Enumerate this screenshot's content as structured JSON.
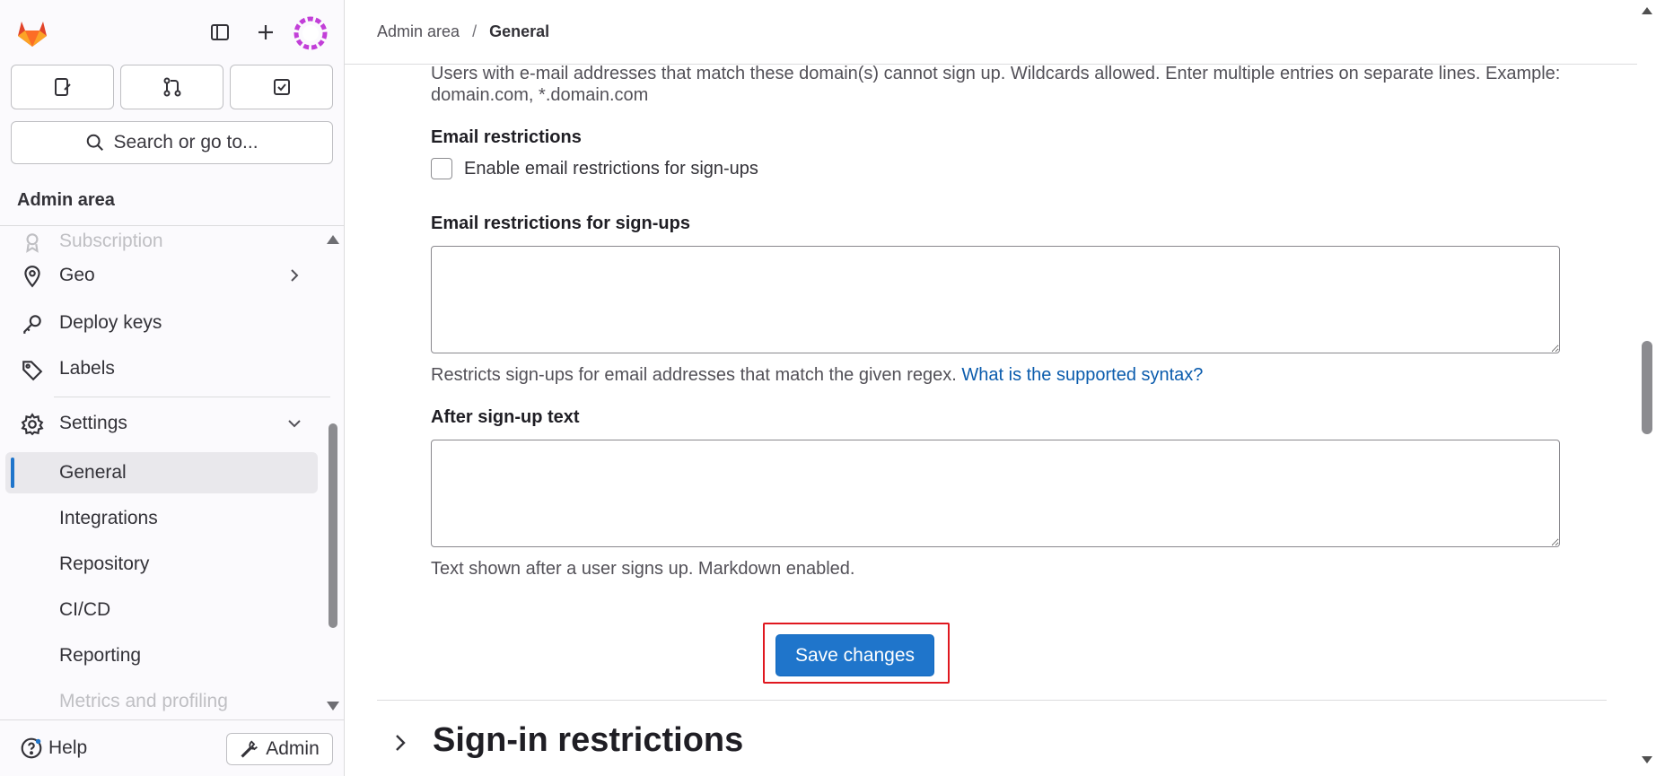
{
  "sidebar": {
    "search_label": "Search or go to...",
    "section_title": "Admin area",
    "items": [
      {
        "label": "Subscription",
        "icon": "subscription-icon"
      },
      {
        "label": "Geo",
        "icon": "location-icon"
      },
      {
        "label": "Deploy keys",
        "icon": "key-icon"
      },
      {
        "label": "Labels",
        "icon": "label-icon"
      },
      {
        "label": "Settings",
        "icon": "settings-icon"
      },
      {
        "label": "General"
      },
      {
        "label": "Integrations"
      },
      {
        "label": "Repository"
      },
      {
        "label": "CI/CD"
      },
      {
        "label": "Reporting"
      },
      {
        "label": "Metrics and profiling"
      }
    ],
    "help_label": "Help",
    "admin_label": "Admin"
  },
  "breadcrumb": {
    "parent": "Admin area",
    "separator": "/",
    "current": "General"
  },
  "form": {
    "domain_denylist_help": "Users with e-mail addresses that match these domain(s) cannot sign up. Wildcards allowed. Enter multiple entries on separate lines. Example: domain.com, *.domain.com",
    "email_restrictions_label": "Email restrictions",
    "email_restrictions_checkbox": "Enable email restrictions for sign-ups",
    "email_restrictions_field_label": "Email restrictions for sign-ups",
    "email_restrictions_field_value": "",
    "email_restrictions_help": "Restricts sign-ups for email addresses that match the given regex.",
    "email_restrictions_help_link": "What is the supported syntax?",
    "after_signup_label": "After sign-up text",
    "after_signup_value": "",
    "after_signup_help": "Text shown after a user signs up. Markdown enabled.",
    "save_button": "Save changes"
  },
  "next_section": {
    "title": "Sign-in restrictions"
  },
  "colors": {
    "accent": "#1f75cb",
    "highlight_outline": "#e0181f",
    "link": "#0b5cad"
  }
}
